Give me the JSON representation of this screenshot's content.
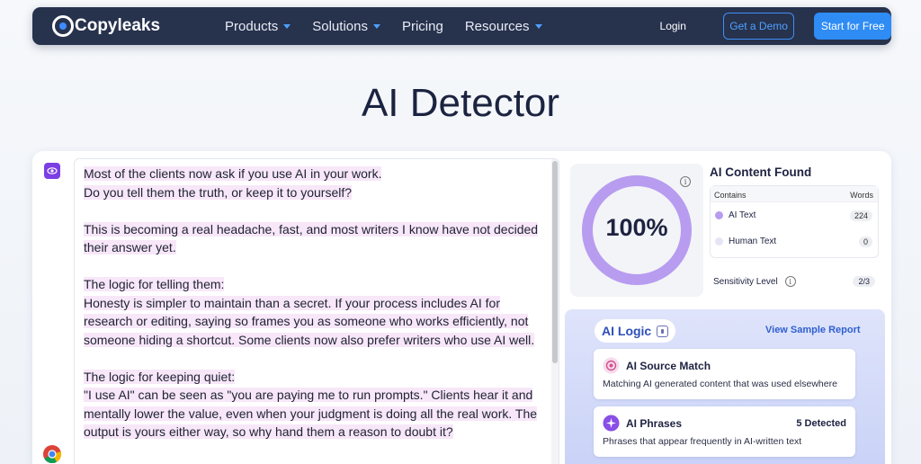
{
  "nav": {
    "brand": "Copyleaks",
    "menu": [
      {
        "label": "Products",
        "has_dropdown": true
      },
      {
        "label": "Solutions",
        "has_dropdown": true
      },
      {
        "label": "Pricing",
        "has_dropdown": false
      },
      {
        "label": "Resources",
        "has_dropdown": true
      }
    ],
    "login": "Login",
    "demo": "Get a Demo",
    "start": "Start for Free"
  },
  "page_title": "AI Detector",
  "editor": {
    "lines": [
      "Most of the clients now ask if you use AI in your work.",
      "Do you tell them the truth, or keep it to yourself?",
      "",
      "This is becoming a real headache, fast, and most writers I know have not decided",
      "their answer yet.",
      "",
      "The logic for telling them:",
      "Honesty is simpler to maintain than a secret. If your process includes AI for",
      "research or editing, saying so frames you as someone who works efficiently, not",
      "someone hiding a shortcut. Some clients now also prefer writers who use AI well.",
      "",
      "The logic for keeping quiet:",
      "\"I use AI\" can be seen as \"you are paying me to run prompts.\" Clients hear it and",
      "mentally lower the value, even when your judgment is doing all the real work. The",
      "output is yours either way, so why hand them a reason to doubt it?"
    ]
  },
  "score": {
    "value": "100%",
    "fraction": 1.0
  },
  "result": {
    "title": "AI Content Found",
    "col_contains": "Contains",
    "col_words": "Words",
    "rows": [
      {
        "label": "AI Text",
        "count": "224",
        "color": "#b79cf0"
      },
      {
        "label": "Human Text",
        "count": "0",
        "color": "#e6e4f5"
      }
    ],
    "sensitivity_label": "Sensitivity Level",
    "sensitivity_value": "2/3"
  },
  "logic": {
    "chip": "AI Logic",
    "view_sample": "View Sample Report",
    "cards": [
      {
        "title": "AI Source Match",
        "desc": "Matching AI generated content that was used elsewhere",
        "count": ""
      },
      {
        "title": "AI Phrases",
        "desc": "Phrases that appear frequently in AI-written text",
        "count": "5 Detected"
      }
    ]
  },
  "colors": {
    "nav_bg": "#27324d",
    "accent_blue": "#2f8cf5",
    "ai_purple": "#b79cf0",
    "highlight": "#f7e7f8"
  }
}
